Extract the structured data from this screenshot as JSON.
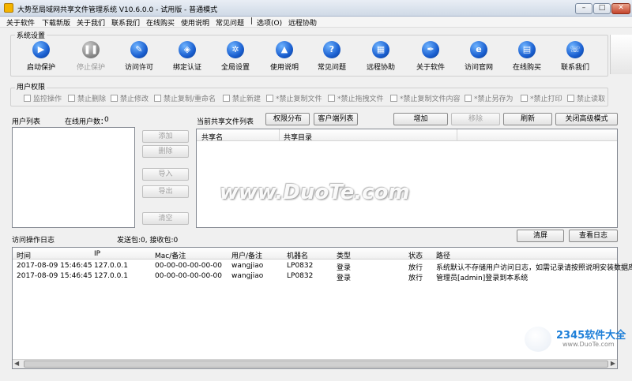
{
  "window": {
    "title": "大势至局域网共享文件管理系统 V10.6.0.0 - 试用版 - 普通模式",
    "min": "0",
    "max": "1",
    "close": "r"
  },
  "menu": [
    "关于软件",
    "下载新版",
    "关于我们",
    "联系我们",
    "在线购买",
    "使用说明",
    "常见问题",
    "|",
    "选项(O)",
    "远程协助"
  ],
  "system_settings": {
    "label": "系统设置",
    "tools": [
      {
        "label": "启动保护",
        "icon": "play-icon",
        "glyph": "▶",
        "enabled": true
      },
      {
        "label": "停止保护",
        "icon": "pause-icon",
        "glyph": "❚❚",
        "enabled": false
      },
      {
        "label": "访问许可",
        "icon": "key-icon",
        "glyph": "✎",
        "enabled": true
      },
      {
        "label": "绑定认证",
        "icon": "shield-icon",
        "glyph": "◈",
        "enabled": true
      },
      {
        "label": "全局设置",
        "icon": "gear-icon",
        "glyph": "✲",
        "enabled": true
      },
      {
        "label": "使用说明",
        "icon": "mortarboard-icon",
        "glyph": "▲",
        "enabled": true
      },
      {
        "label": "常见问题",
        "icon": "question-icon",
        "glyph": "?",
        "enabled": true
      },
      {
        "label": "远程协助",
        "icon": "remote-icon",
        "glyph": "▦",
        "enabled": true
      },
      {
        "label": "关于软件",
        "icon": "pen-icon",
        "glyph": "✒",
        "enabled": true
      },
      {
        "label": "访问官网",
        "icon": "ie-icon",
        "glyph": "e",
        "enabled": true
      },
      {
        "label": "在线购买",
        "icon": "cart-icon",
        "glyph": "▤",
        "enabled": true
      },
      {
        "label": "联系我们",
        "icon": "phone-icon",
        "glyph": "☏",
        "enabled": true
      }
    ]
  },
  "user_permissions": {
    "label": "用户权限",
    "items": [
      "监控操作",
      "禁止删除",
      "禁止修改",
      "禁止复制/重命名",
      "禁止新建",
      "*禁止复制文件",
      "*禁止拖拽文件",
      "*禁止复制文件内容",
      "*禁止另存为",
      "*禁止打印",
      "禁止读取"
    ]
  },
  "user_list": {
    "label": "用户列表",
    "online_label": "在线用户数：",
    "online_count": "0",
    "buttons": {
      "add": "添加",
      "delete": "删除",
      "import": "导入",
      "export": "导出",
      "clear": "清空"
    }
  },
  "shares": {
    "label": "当前共享文件列表",
    "perm_btn": "权限分布",
    "client_btn": "客户端列表",
    "add_btn": "增加",
    "remove_btn": "移除",
    "refresh_btn": "刷新",
    "advanced_btn": "关闭高级模式",
    "columns": [
      "共享名",
      "共享目录"
    ]
  },
  "log": {
    "label": "访问操作日志",
    "packets": "发送包:0, 接收包:0",
    "clear_btn": "清屏",
    "view_btn": "查看日志",
    "columns": [
      "时间",
      "IP",
      "Mac/备注",
      "用户/备注",
      "机器名",
      "类型",
      "状态",
      "路径"
    ],
    "rows": [
      [
        "2017-08-09 15:46:45",
        "127.0.0.1",
        "00-00-00-00-00-00",
        "wangjiao",
        "LP0832",
        "登录",
        "放行",
        "系统默认不存储用户访问日志，如需记录请按照说明安装数据库"
      ],
      [
        "2017-08-09 15:46:45",
        "127.0.0.1",
        "00-00-00-00-00-00",
        "wangjiao",
        "LP0832",
        "登录",
        "放行",
        "管理员[admin]登录到本系统"
      ]
    ]
  },
  "watermark": "www.DuoTe.com",
  "logo_text": "2345软件大全",
  "logo_url": "www.DuoTe.com"
}
